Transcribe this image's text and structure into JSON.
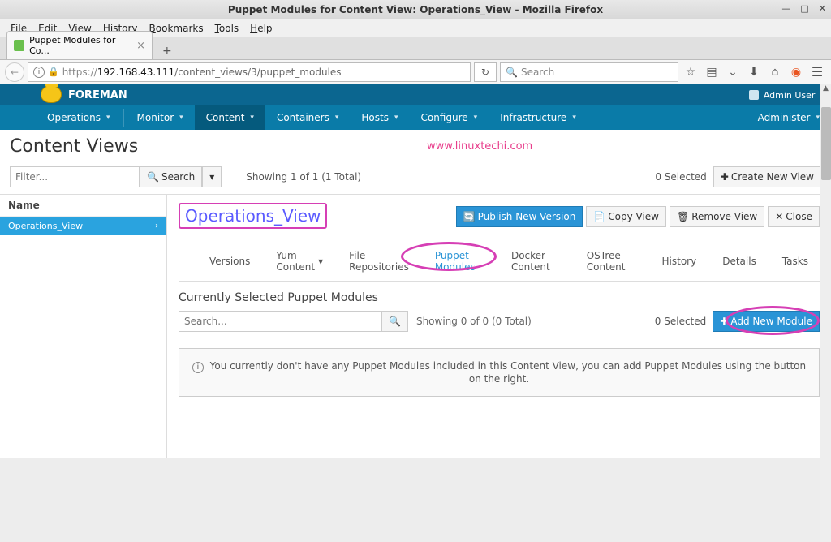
{
  "window": {
    "title": "Puppet Modules for Content View: Operations_View - Mozilla Firefox"
  },
  "menubar": [
    "File",
    "Edit",
    "View",
    "History",
    "Bookmarks",
    "Tools",
    "Help"
  ],
  "tab": {
    "title": "Puppet Modules for Co..."
  },
  "url": {
    "host": "192.168.43.111",
    "path": "/content_views/3/puppet_modules",
    "search_placeholder": "Search"
  },
  "brand": {
    "name": "FOREMAN",
    "user": "Admin User"
  },
  "mainnav": [
    "Operations",
    "Monitor",
    "Content",
    "Containers",
    "Hosts",
    "Configure",
    "Infrastructure"
  ],
  "mainnav_right": "Administer",
  "page_title": "Content Views",
  "watermark": "www.linuxtechi.com",
  "filter": {
    "placeholder": "Filter...",
    "search_btn": "Search"
  },
  "showing_outer": "Showing 1 of 1 (1 Total)",
  "selected_outer": "0 Selected",
  "create_btn": "Create New View",
  "leftcol": {
    "header": "Name",
    "item": "Operations_View"
  },
  "view": {
    "title": "Operations_View",
    "buttons": {
      "publish": "Publish New Version",
      "copy": "Copy View",
      "remove": "Remove View",
      "close": "Close"
    },
    "tabs": [
      "Versions",
      "Yum Content",
      "File Repositories",
      "Puppet Modules",
      "Docker Content",
      "OSTree Content",
      "History",
      "Details",
      "Tasks"
    ],
    "subtitle": "Currently Selected Puppet Modules",
    "mod_search_placeholder": "Search...",
    "showing_inner": "Showing 0 of 0 (0 Total)",
    "selected_inner": "0 Selected",
    "add_btn": "Add New Module",
    "empty_msg": "You currently don't have any Puppet Modules included in this Content View, you can add Puppet Modules using the button on the right."
  }
}
